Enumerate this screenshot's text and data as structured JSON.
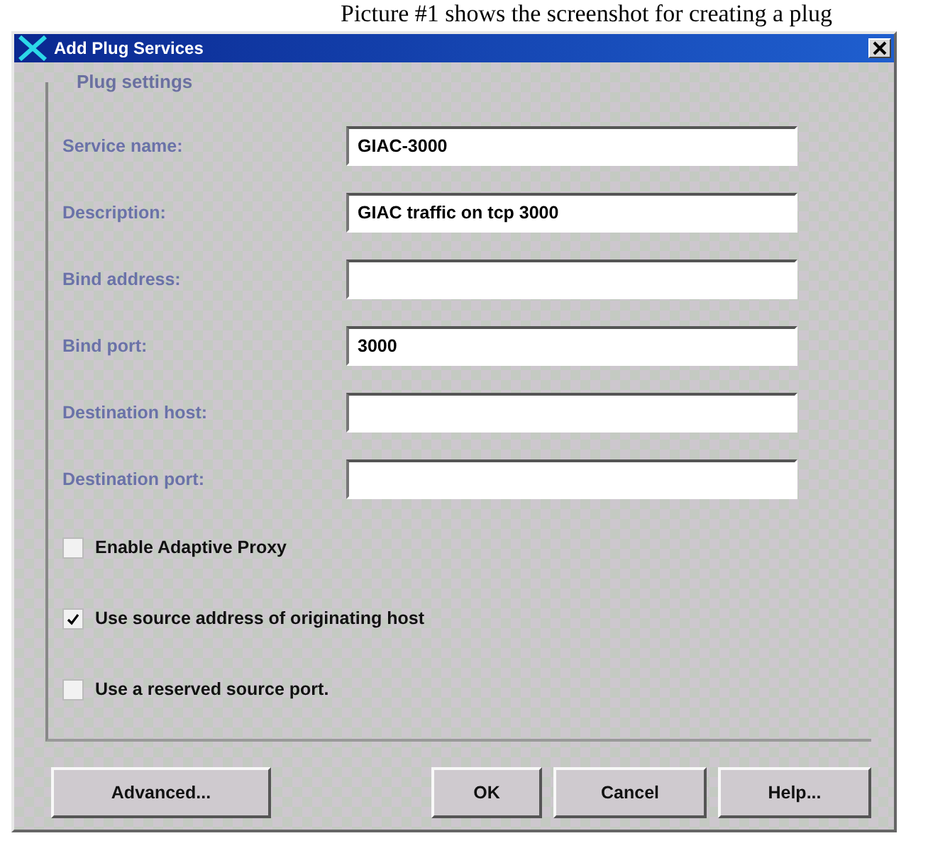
{
  "caption": "Picture #1 shows the screenshot for creating a plug",
  "window": {
    "title": "Add Plug Services"
  },
  "group": {
    "title": "Plug settings",
    "fields": [
      {
        "label": "Service name:",
        "value": "GIAC-3000"
      },
      {
        "label": "Description:",
        "value": "GIAC traffic on tcp 3000"
      },
      {
        "label": "Bind address:"
      },
      {
        "label": "Bind port:",
        "value": "3000"
      },
      {
        "label": "Destination host:"
      },
      {
        "label": "Destination port:"
      }
    ],
    "checkboxes": [
      {
        "label": "Enable Adaptive Proxy",
        "checked": false
      },
      {
        "label": "Use source address of originating host",
        "checked": true
      },
      {
        "label": "Use a reserved source port.",
        "checked": false
      }
    ]
  },
  "buttons": {
    "left": [
      "Advanced..."
    ],
    "right": [
      "OK",
      "Cancel",
      "Help..."
    ]
  }
}
